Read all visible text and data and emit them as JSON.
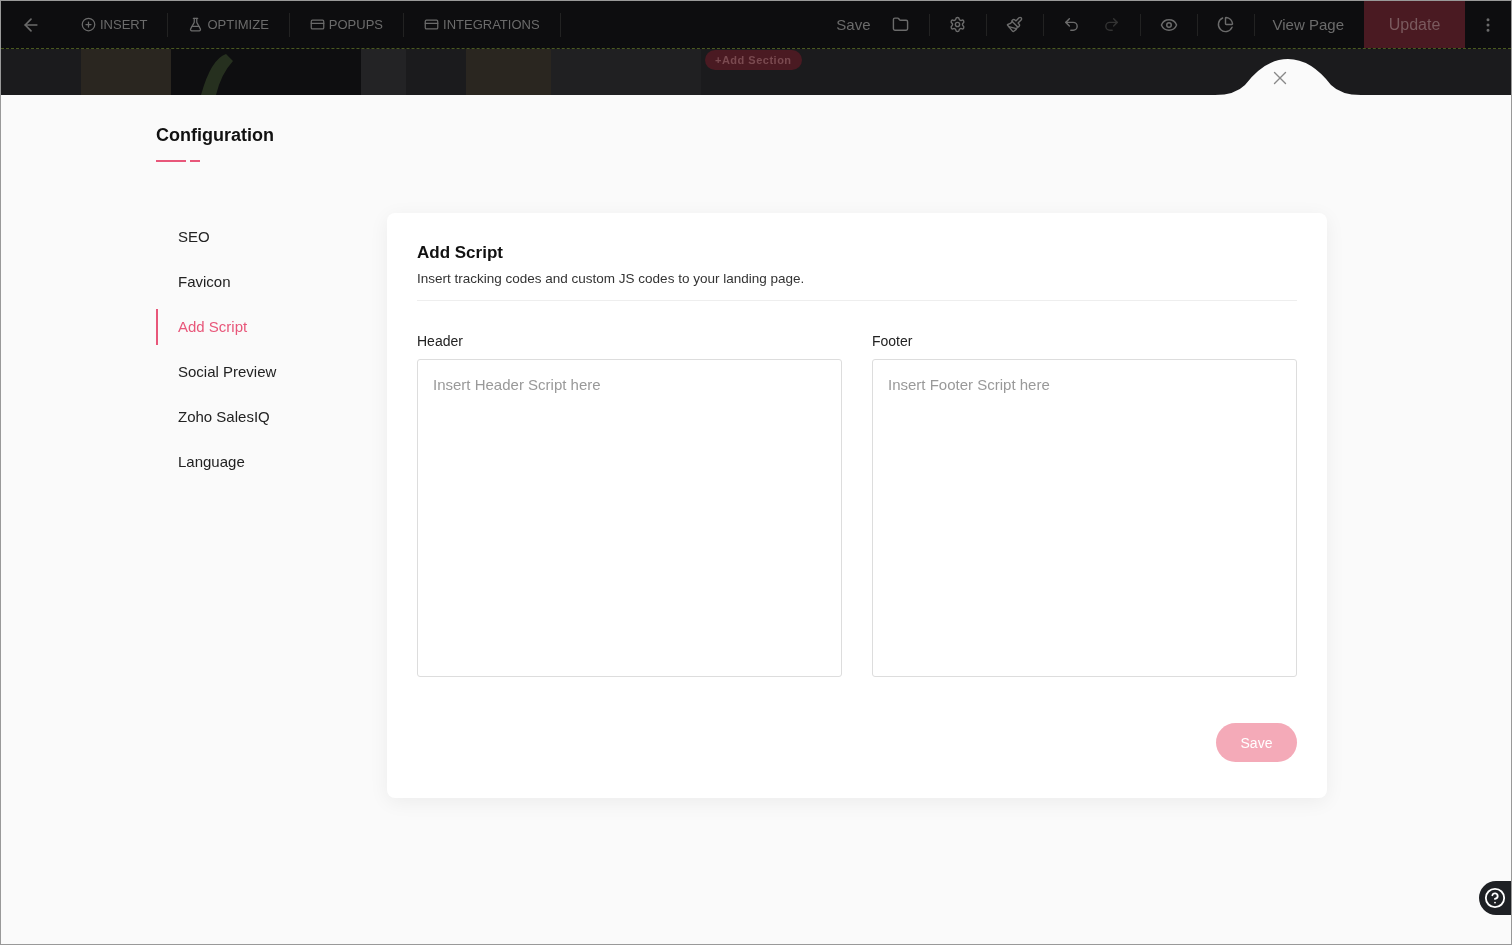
{
  "toolbar": {
    "menus": [
      {
        "kind": "insert",
        "label": "INSERT"
      },
      {
        "kind": "optimize",
        "label": "OPTIMIZE"
      },
      {
        "kind": "popups",
        "label": "POPUPS"
      },
      {
        "kind": "integrations",
        "label": "INTEGRATIONS"
      }
    ],
    "save": "Save",
    "view_page": "View Page",
    "update": "Update"
  },
  "canvas": {
    "add_section": "+Add Section"
  },
  "panel": {
    "title": "Configuration",
    "sidebar": [
      {
        "label": "SEO",
        "selected": false
      },
      {
        "label": "Favicon",
        "selected": false
      },
      {
        "label": "Add Script",
        "selected": true
      },
      {
        "label": "Social Preview",
        "selected": false
      },
      {
        "label": "Zoho SalesIQ",
        "selected": false
      },
      {
        "label": "Language",
        "selected": false
      }
    ],
    "card": {
      "title": "Add Script",
      "description": "Insert tracking codes and custom JS codes to your landing page.",
      "fields": [
        {
          "label": "Header",
          "placeholder": "Insert Header Script here"
        },
        {
          "label": "Footer",
          "placeholder": "Insert Footer Script here"
        }
      ],
      "save": "Save"
    }
  }
}
